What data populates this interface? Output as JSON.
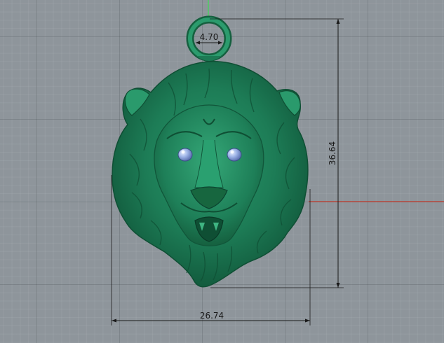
{
  "viewport": {
    "dimensions": {
      "ring_inner": "4.70",
      "height": "36.64",
      "width": "26.74"
    }
  },
  "colors": {
    "background": "#8e959b",
    "model": "#1e7a55",
    "gem": "#8fa7d8",
    "dimension_line": "#1a1a1a",
    "x_axis": "#c0392b",
    "y_axis": "#2ecc40"
  }
}
